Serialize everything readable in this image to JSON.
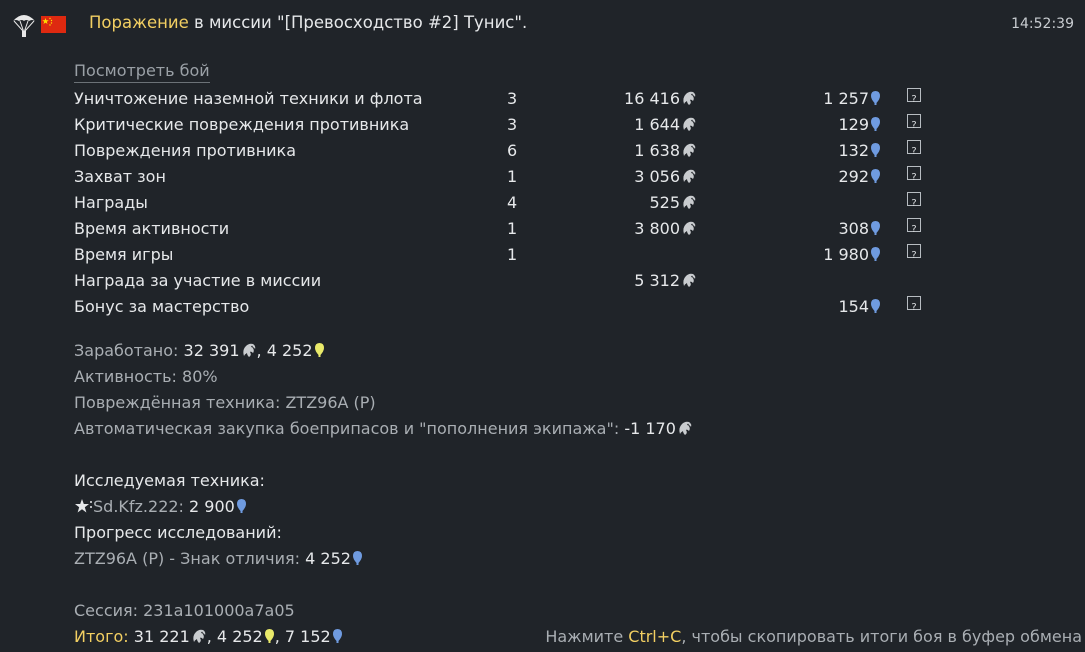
{
  "header": {
    "result": "Поражение",
    "text": " в миссии \"[Превосходство #2] Тунис\".",
    "time": "14:52:39",
    "icons": [
      "parachute-icon",
      "china-flag-icon"
    ]
  },
  "view_battle_link": "Посмотреть бой",
  "rows": [
    {
      "label": "Уничтожение наземной техники и флота",
      "count": "3",
      "sl": "16 416",
      "rp": "1 257",
      "help": true
    },
    {
      "label": "Критические повреждения противника",
      "count": "3",
      "sl": "1 644",
      "rp": "129",
      "help": true
    },
    {
      "label": "Повреждения противника",
      "count": "6",
      "sl": "1 638",
      "rp": "132",
      "help": true
    },
    {
      "label": "Захват зон",
      "count": "1",
      "sl": "3 056",
      "rp": "292",
      "help": true
    },
    {
      "label": "Награды",
      "count": "4",
      "sl": "525",
      "rp": "",
      "help": true
    },
    {
      "label": "Время активности",
      "count": "1",
      "sl": "3 800",
      "rp": "308",
      "help": true
    },
    {
      "label": "Время игры",
      "count": "1",
      "sl": "",
      "rp": "1 980",
      "help": true
    },
    {
      "label": "Награда за участие в миссии",
      "count": "",
      "sl": "5 312",
      "rp": "",
      "help": false
    },
    {
      "label": "Бонус за мастерство",
      "count": "",
      "sl": "",
      "rp": "154",
      "help": true
    }
  ],
  "summary": {
    "earned_label": "Заработано:",
    "earned_sl": "32 391",
    "earned_sep": ", ",
    "earned_crp": "4 252",
    "activity_label": "Активность:",
    "activity_value": "80%",
    "damaged_label": "Повреждённая техника:",
    "damaged_value": "ZTZ96A (P)",
    "autobuy_label": "Автоматическая закупка боеприпасов и \"пополнения экипажа\":",
    "autobuy_value": "-1 170"
  },
  "research": {
    "heading": "Исследуемая техника:",
    "vehicle_name": "Sd.Kfz.222:",
    "vehicle_rp": "2 900",
    "progress_heading": "Прогресс исследований:",
    "progress_label": "ZTZ96A (P) - Знак отличия:",
    "progress_value": "4 252"
  },
  "session": {
    "label": "Сессия:",
    "value": "231a101000a7a05"
  },
  "total": {
    "label": "Итого:",
    "sl": "31 221",
    "sep1": ", ",
    "crp": "4 252",
    "sep2": ", ",
    "rp": "7 152"
  },
  "hint": {
    "prefix": "Нажмите ",
    "keys": "Ctrl+C",
    "suffix": ", чтобы скопировать итоги боя в буфер обмена"
  },
  "colors": {
    "background": "#202429",
    "accent_yellow": "#f2cf62",
    "rp_blue": "#6f9be0",
    "crp_yellow": "#e9ea6a",
    "silver": "#c9cccf"
  }
}
